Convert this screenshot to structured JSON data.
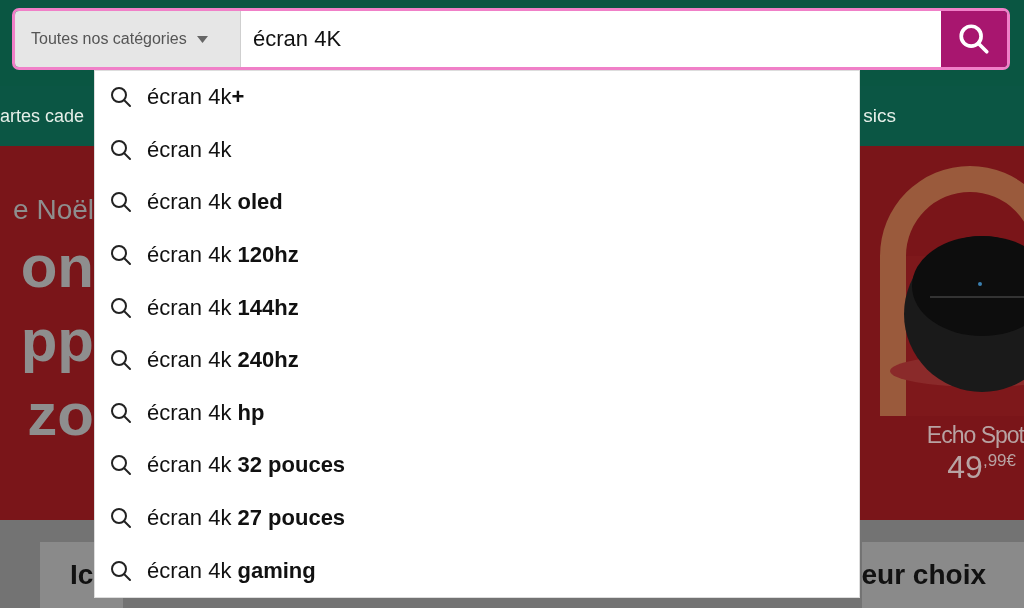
{
  "search": {
    "category": "Toutes nos catégories",
    "value": "écran 4K"
  },
  "nav": {
    "left": "artes cade",
    "right": "sics"
  },
  "banner": {
    "lines": [
      {
        "text": "e Noël",
        "kind": "small"
      },
      {
        "text": "on",
        "kind": "big"
      },
      {
        "text": "pp",
        "kind": "big"
      },
      {
        "text": "zo",
        "kind": "big"
      }
    ],
    "product": {
      "kind": "picture",
      "name": "Echo Spot",
      "price": "49$^{,99€}$"
    }
  },
  "cards": [
    "Ic",
    "eur choix"
  ],
  "suggestions": [
    {
      "text": "écran 4k**+**"
    },
    {
      "text": "écran 4k"
    },
    {
      "text": "écran 4k **oled**"
    },
    {
      "text": "écran 4k **120hz**"
    },
    {
      "text": "écran 4k **144hz**"
    },
    {
      "text": "écran 4k **240hz**"
    },
    {
      "text": "écran 4k **hp**"
    },
    {
      "text": "écran 4k **32 pouces**"
    },
    {
      "text": "écran 4k **27 pouces**"
    },
    {
      "text": "écran 4k **gaming**"
    }
  ]
}
